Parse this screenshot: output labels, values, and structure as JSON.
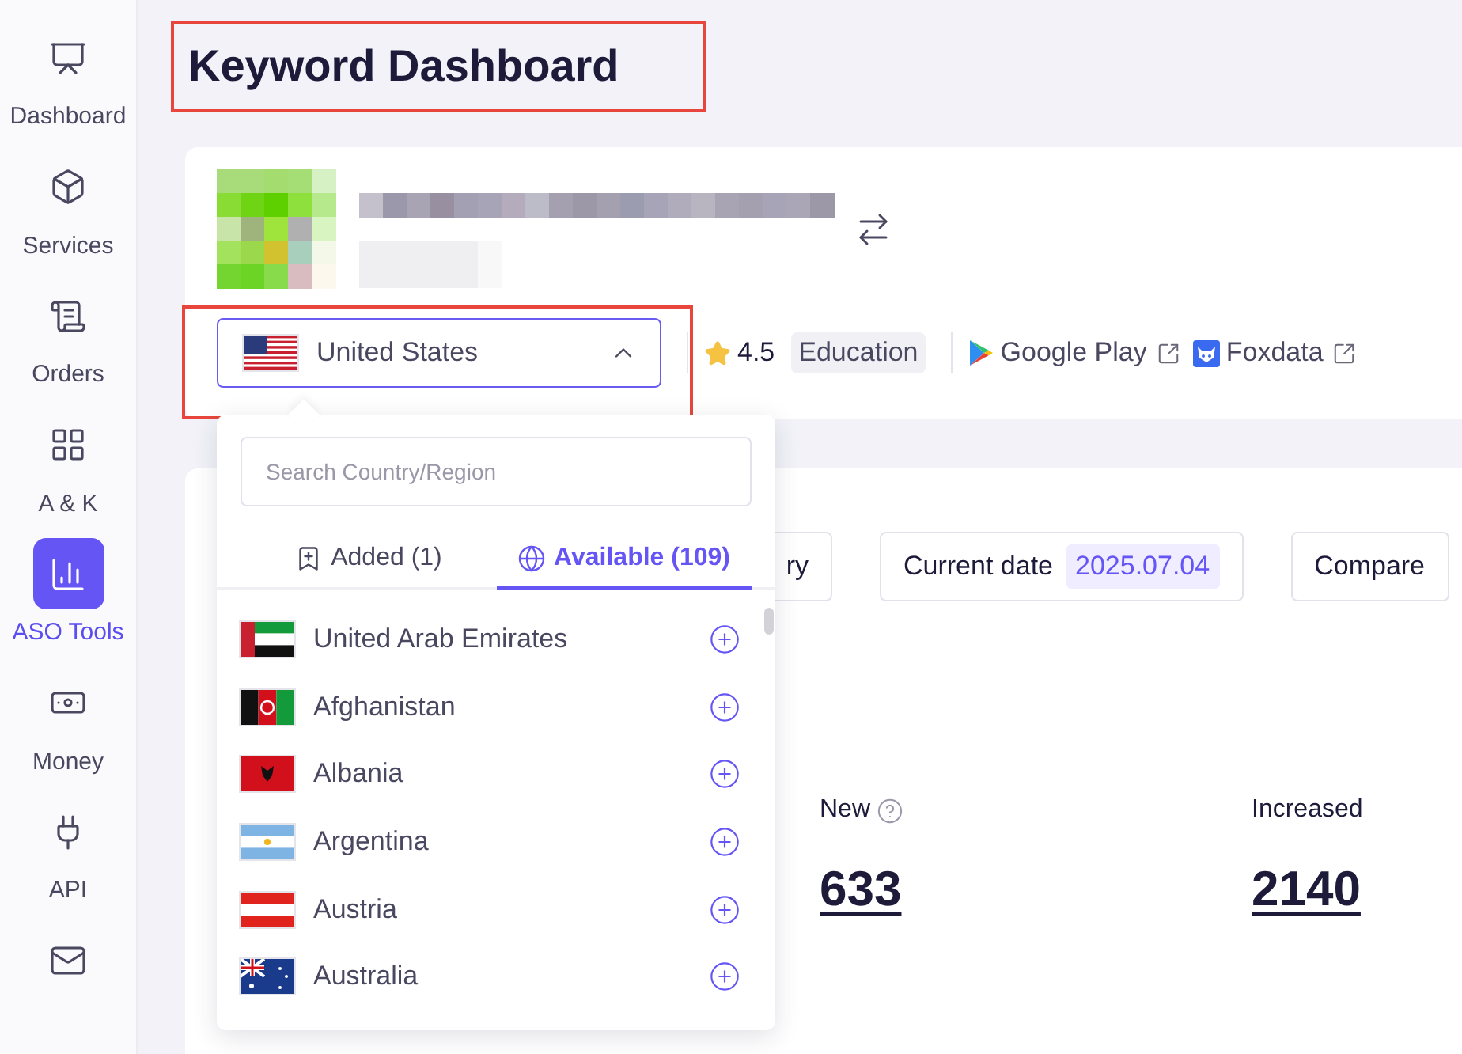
{
  "sidebar": {
    "items": [
      {
        "label": "Dashboard",
        "kind": "dashboard",
        "selected": false
      },
      {
        "label": "Services",
        "kind": "services",
        "selected": false
      },
      {
        "label": "Orders",
        "kind": "orders",
        "selected": false
      },
      {
        "label": "A & K",
        "kind": "grid",
        "selected": false
      },
      {
        "label": "ASO Tools",
        "kind": "aso",
        "selected": true
      },
      {
        "label": "Money",
        "kind": "money",
        "selected": false
      },
      {
        "label": "API",
        "kind": "api",
        "selected": false
      },
      {
        "kind": "mail",
        "selected": false
      }
    ]
  },
  "page_title": "Keyword Dashboard",
  "app": {
    "rating": "4.5",
    "category": "Education",
    "links": [
      {
        "label": "Google Play",
        "kind": "google-play"
      },
      {
        "label": "Foxdata",
        "kind": "foxdata"
      }
    ]
  },
  "country_select": {
    "value": "United States",
    "kind": "us",
    "expanded": true
  },
  "dropdown": {
    "search": {
      "placeholder": "Search Country/Region"
    },
    "tabs": [
      {
        "label": "Added (1)",
        "kind": "bookmark",
        "selected": false
      },
      {
        "label": "Available (109)",
        "kind": "globe",
        "selected": true
      }
    ],
    "countries": [
      {
        "name": "United Arab Emirates",
        "kind": "ae"
      },
      {
        "name": "Afghanistan",
        "kind": "af"
      },
      {
        "name": "Albania",
        "kind": "al"
      },
      {
        "name": "Argentina",
        "kind": "ar"
      },
      {
        "name": "Austria",
        "kind": "at"
      },
      {
        "name": "Australia",
        "kind": "au"
      }
    ]
  },
  "toolbar": {
    "buttons": [
      {
        "label": "ry",
        "kind": "plain"
      },
      {
        "label": "Current date",
        "value": "2025.07.04",
        "kind": "date"
      },
      {
        "label": "Compare",
        "kind": "plain"
      }
    ]
  },
  "stats": [
    {
      "label": "New",
      "help": true,
      "value": "633"
    },
    {
      "label": "Increased",
      "help": false,
      "value": "2140"
    }
  ]
}
